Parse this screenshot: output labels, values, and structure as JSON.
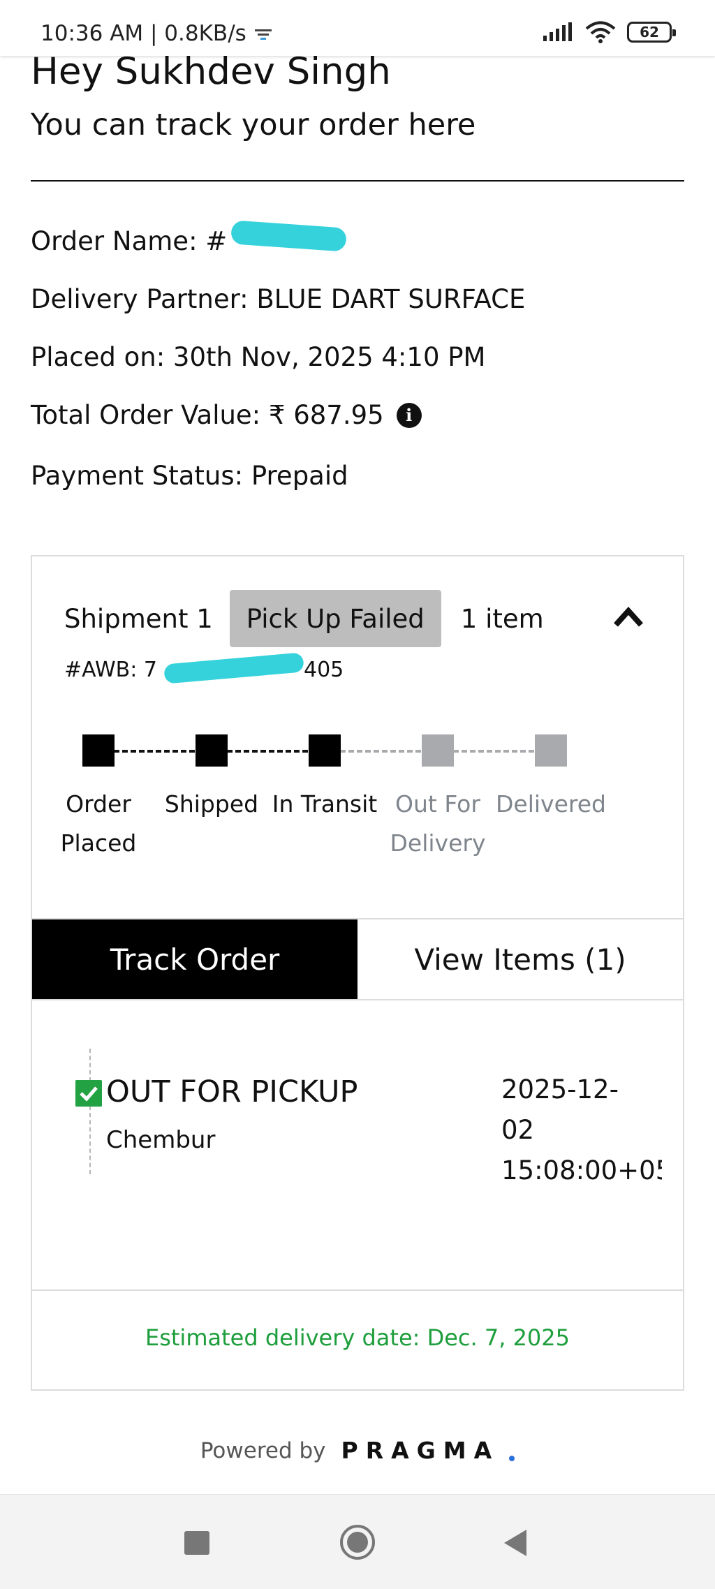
{
  "status_bar": {
    "time_speed": "10:36 AM | 0.8KB/s",
    "battery": "62",
    "icons": [
      "data-saver-icon",
      "signal-icon",
      "wifi-icon",
      "battery-icon"
    ]
  },
  "header": {
    "greeting": "Hey Sukhdev Singh",
    "subtitle": "You can track your order here"
  },
  "order": {
    "name_label": "Order Name: #",
    "partner": "Delivery Partner: BLUE DART SURFACE",
    "placed": "Placed on: 30th Nov, 2025 4:10 PM",
    "total_label": "Total Order Value: ₹ 687.95",
    "payment": "Payment Status: Prepaid"
  },
  "shipment": {
    "title": "Shipment 1",
    "status_badge": "Pick Up Failed",
    "item_count": "1 item",
    "awb_label": "#AWB: 7",
    "awb_suffix": "405",
    "steps": [
      {
        "label": "Order Placed",
        "done": true
      },
      {
        "label": "Shipped",
        "done": true
      },
      {
        "label": "In Transit",
        "done": true
      },
      {
        "label": "Out For Delivery",
        "done": false
      },
      {
        "label": "Delivered",
        "done": false
      }
    ],
    "tabs": {
      "track": "Track Order",
      "items": "View Items (1)"
    },
    "event": {
      "title": "OUT FOR PICKUP",
      "location": "Chembur",
      "time_line1": "2025-12-",
      "time_line2": "02",
      "time_line3": "15:08:00+05"
    },
    "estimated": "Estimated delivery date: Dec. 7, 2025"
  },
  "footer": {
    "powered_by": "Powered by",
    "brand": "PRAGMA"
  },
  "colors": {
    "accent_green": "#1e9e3c",
    "check_green": "#23a244",
    "redaction": "#35d2dc",
    "badge_grey": "#bdbdbd",
    "pending_grey": "#a9aaad"
  }
}
